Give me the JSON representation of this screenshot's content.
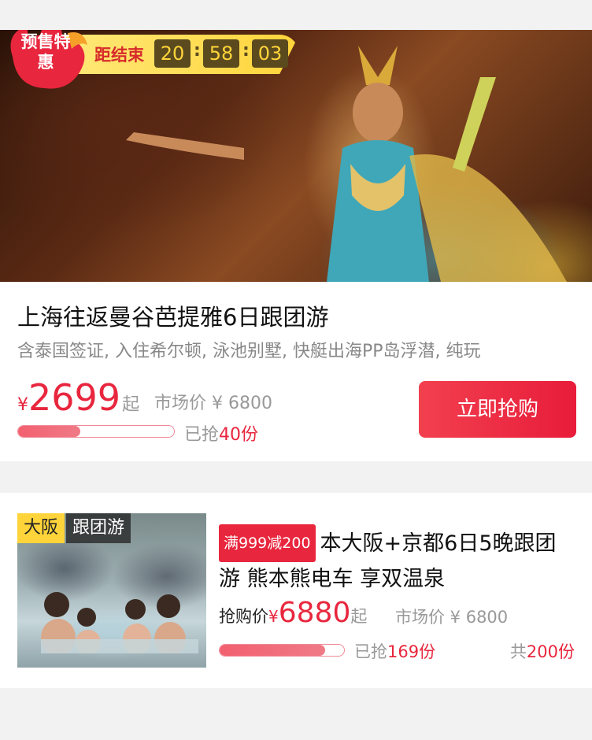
{
  "deal1": {
    "badge": "预售特惠",
    "countdown_label": "距结束",
    "countdown": {
      "hours": "20",
      "minutes": "58",
      "seconds": "03",
      "separator": ":"
    },
    "title": "上海往返曼谷芭提雅6日跟团游",
    "subtitle": "含泰国签证, 入住希尔顿, 泳池别墅, 快艇出海PP岛浮潜, 纯玩",
    "currency": "¥",
    "price": "2699",
    "price_suffix": "起",
    "market_price": "市场价 ¥ 6800",
    "sold_prefix": "已抢",
    "sold": "40份",
    "progress": 0.4,
    "buy_label": "立即抢购"
  },
  "deal2": {
    "city_tag": "大阪",
    "type_tag": "跟团游",
    "promo": "满999减200",
    "title": "本大阪+京都6日5晚跟团游 熊本熊电车 享双温泉",
    "price_label": "抢购价",
    "currency": "¥",
    "price": "6880",
    "price_suffix": "起",
    "market_price": "市场价 ¥ 6800",
    "sold_prefix": "已抢",
    "sold": "169份",
    "total_prefix": "共",
    "total": "200份",
    "progress": 0.845
  },
  "colors": {
    "accent": "#e8263d",
    "badge_yellow": "#ffd43a",
    "muted": "#999999"
  }
}
